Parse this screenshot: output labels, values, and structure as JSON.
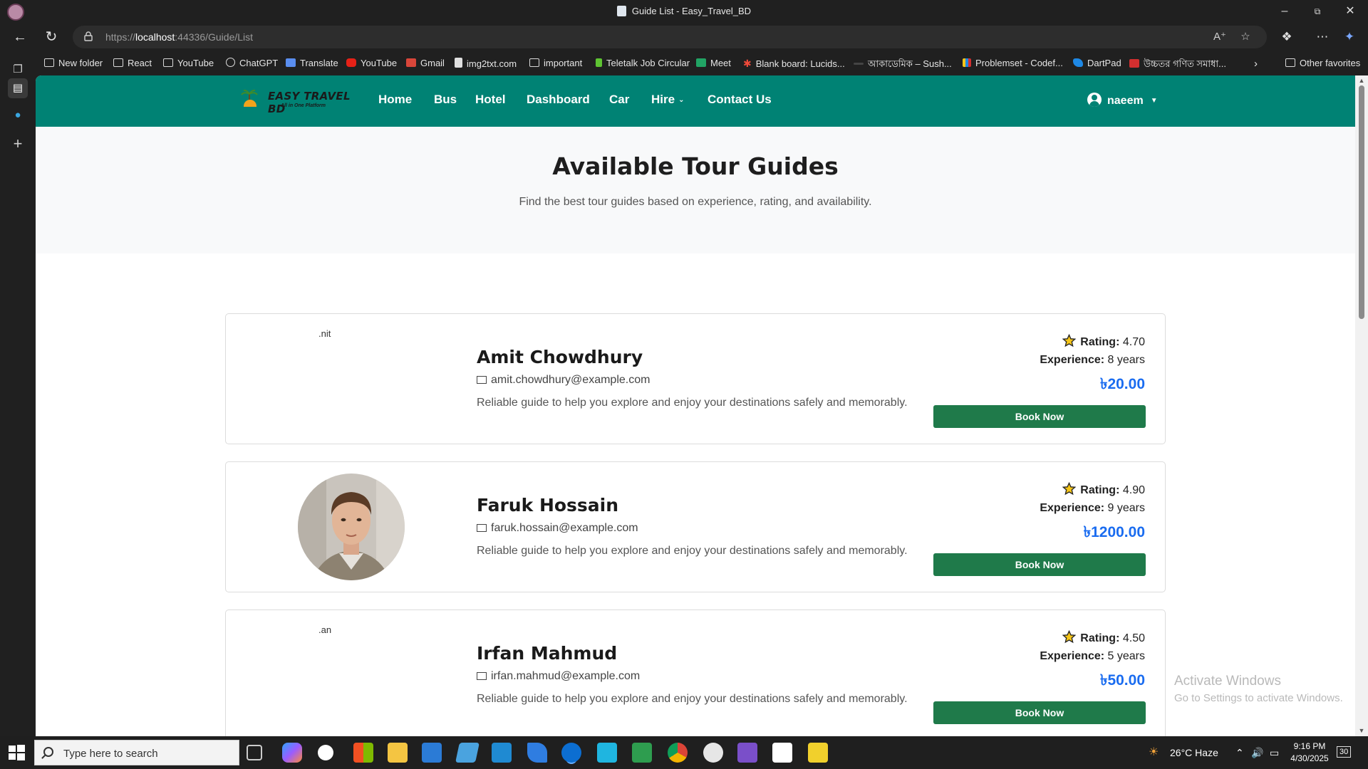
{
  "browser": {
    "window_title": "Guide List - Easy_Travel_BD",
    "url_prefix": "https://",
    "url_host": "localhost",
    "url_rest": ":44336/Guide/List",
    "favorites": [
      {
        "label": "New folder",
        "icon": "folder-icon"
      },
      {
        "label": "React",
        "icon": "folder-icon"
      },
      {
        "label": "YouTube",
        "icon": "folder-icon"
      },
      {
        "label": "ChatGPT",
        "icon": "chatgpt-icon"
      },
      {
        "label": "Translate",
        "icon": "translate-icon"
      },
      {
        "label": "YouTube",
        "icon": "youtube-icon"
      },
      {
        "label": "Gmail",
        "icon": "gmail-icon"
      },
      {
        "label": "img2txt.com",
        "icon": "doc-icon"
      },
      {
        "label": "important",
        "icon": "folder-icon"
      },
      {
        "label": "Teletalk Job Circular",
        "icon": "teletalk-icon"
      },
      {
        "label": "Meet",
        "icon": "meet-icon"
      },
      {
        "label": "Blank board: Lucids...",
        "icon": "lucid-icon"
      },
      {
        "label": "আকাডেমিক – Sush...",
        "icon": "notion-icon"
      },
      {
        "label": "Problemset - Codef...",
        "icon": "codeforces-icon"
      },
      {
        "label": "DartPad",
        "icon": "dart-icon"
      },
      {
        "label": "উচ্চতর গণিত সমাধা...",
        "icon": "pdf-icon"
      }
    ],
    "other_favorites": "Other favorites"
  },
  "site": {
    "brand": "EASY TRAVEL BD",
    "tagline": "All in One Platform",
    "nav": [
      "Home",
      "Bus",
      "Hotel",
      "Dashboard",
      "Car",
      "Hire",
      "Contact Us"
    ],
    "user": "naeem"
  },
  "hero": {
    "title": "Available Tour Guides",
    "subtitle": "Find the best tour guides based on experience, rating, and availability."
  },
  "guides": [
    {
      "alt": ".nit",
      "has_photo": false,
      "name": "Amit Chowdhury",
      "email": "amit.chowdhury@example.com",
      "description": "Reliable guide to help you explore and enjoy your destinations safely and memorably.",
      "rating_label": "Rating:",
      "rating": "4.70",
      "experience_label": "Experience:",
      "experience": "8 years",
      "price": "৳20.00",
      "button": "Book Now"
    },
    {
      "alt": "",
      "has_photo": true,
      "name": "Faruk Hossain",
      "email": "faruk.hossain@example.com",
      "description": "Reliable guide to help you explore and enjoy your destinations safely and memorably.",
      "rating_label": "Rating:",
      "rating": "4.90",
      "experience_label": "Experience:",
      "experience": "9 years",
      "price": "৳1200.00",
      "button": "Book Now"
    },
    {
      "alt": ".an",
      "has_photo": false,
      "name": "Irfan Mahmud",
      "email": "irfan.mahmud@example.com",
      "description": "Reliable guide to help you explore and enjoy your destinations safely and memorably.",
      "rating_label": "Rating:",
      "rating": "4.50",
      "experience_label": "Experience:",
      "experience": "5 years",
      "price": "৳50.00",
      "button": "Book Now"
    }
  ],
  "watermark": {
    "line1": "Activate Windows",
    "line2": "Go to Settings to activate Windows."
  },
  "taskbar": {
    "search_placeholder": "Type here to search",
    "weather": "26°C  Haze",
    "time": "9:16 PM",
    "date": "4/30/2025",
    "notification_count": "30"
  },
  "colors": {
    "nav_bg": "#008274",
    "button_bg": "#1f7a4a",
    "price": "#1a6cf0",
    "hero_bg": "#f8f9fa"
  }
}
